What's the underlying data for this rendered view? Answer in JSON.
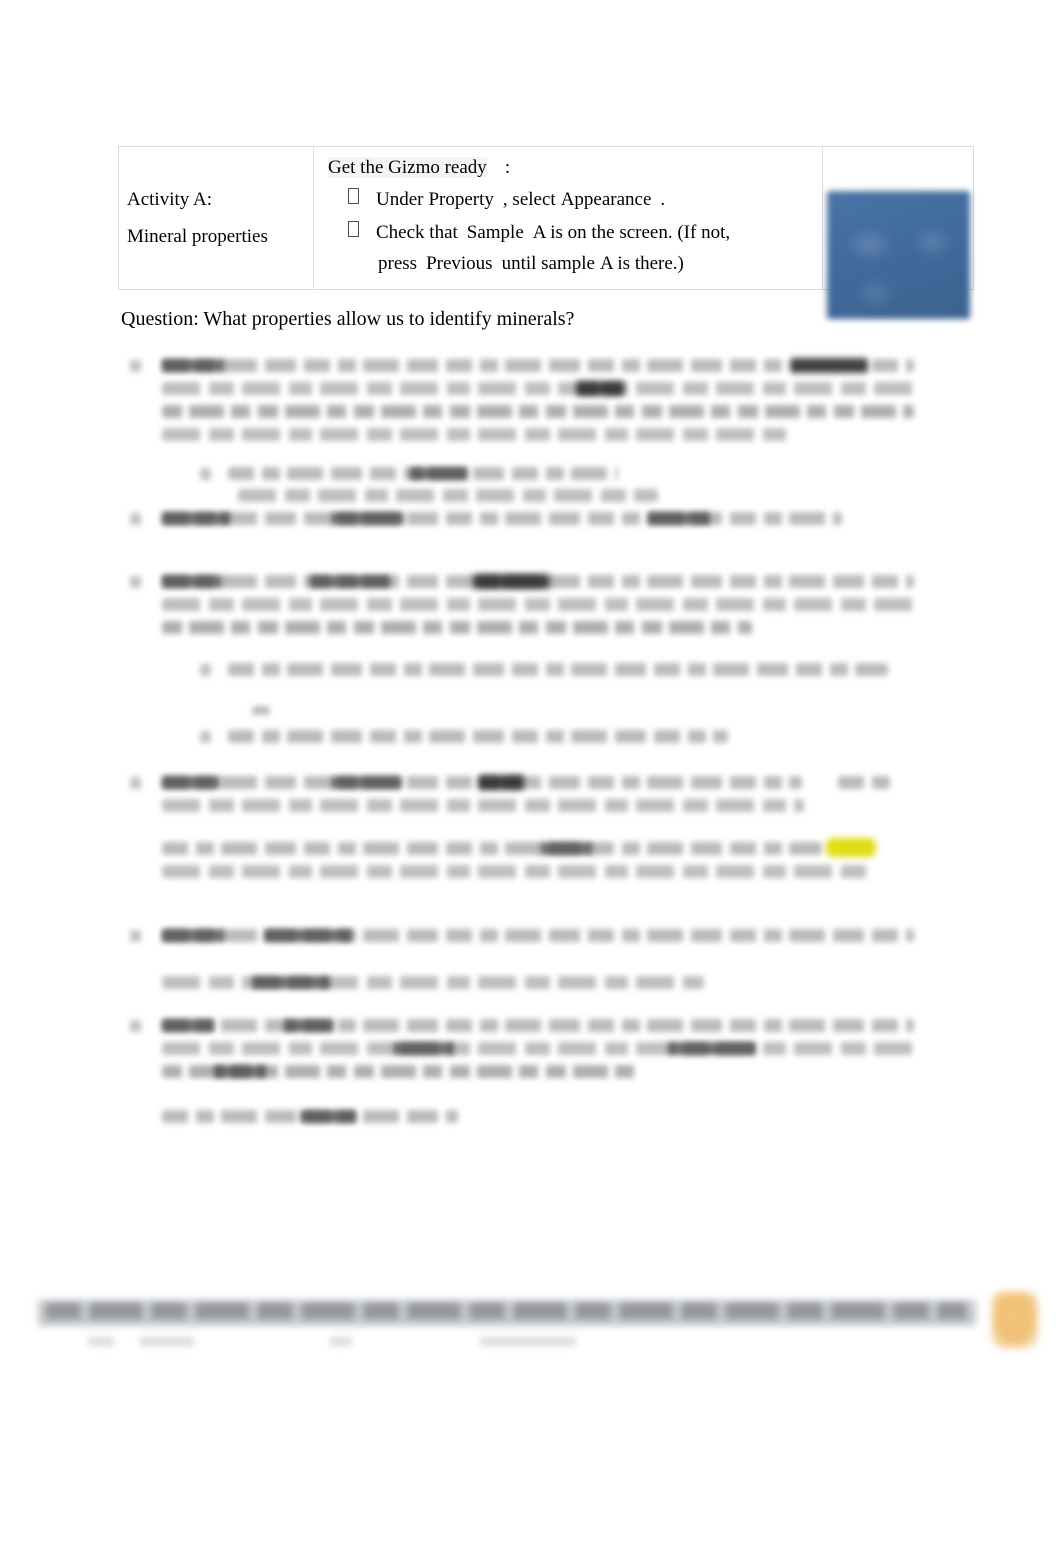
{
  "document": {
    "type": "worksheet",
    "question_line": "Question: What properties allow us to identify minerals?"
  },
  "activity_table": {
    "activity_cell": {
      "title": "Activity A:",
      "subtitle": "Mineral properties"
    },
    "instructions_cell": {
      "heading": "Get the Gizmo ready",
      "heading_colon": ":",
      "bullets": [
        {
          "icon": "bullet-box",
          "segments": [
            {
              "text": "Under",
              "bold": false
            },
            {
              "text": "Property",
              "bold": false
            },
            {
              "text": ", select",
              "bold": false
            },
            {
              "text": "Appearance",
              "bold": false
            },
            {
              "text": ".",
              "bold": false
            }
          ]
        },
        {
          "icon": "bullet-box",
          "segments": [
            {
              "text": "Check that",
              "bold": false
            },
            {
              "text": "Sample",
              "bold": false
            },
            {
              "text": "A is on the screen. (If not,",
              "bold": false
            },
            {
              "text": "press",
              "bold": false
            },
            {
              "text": "Previous",
              "bold": false
            },
            {
              "text": "until sample",
              "bold": false
            },
            {
              "text": "A is there.)",
              "bold": false
            }
          ]
        }
      ]
    },
    "image_cell": {
      "alt": "gizmo-screenshot-thumbnail",
      "state": "blurred",
      "color": "#416a9c"
    }
  },
  "body": {
    "state": "blurred-illegible",
    "note": "Numbered activity items with sub-lettered questions; text obscured.",
    "items": [
      {
        "number": "1.",
        "lines": 4,
        "has_redaction": true
      },
      {
        "sub": "a.",
        "lines": 2
      },
      {
        "number": "2.",
        "lines": 1,
        "has_bold": true
      },
      {
        "number": "3.",
        "lines": 3,
        "has_redaction": true
      },
      {
        "sub": "a.",
        "lines": 1
      },
      {
        "sub": "b.",
        "lines": 1
      },
      {
        "number": "4.",
        "lines": 2,
        "has_redaction": true
      },
      {
        "paragraph": true,
        "lines": 2,
        "has_highlight": true
      },
      {
        "number": "5.",
        "lines": 1
      },
      {
        "paragraph": true,
        "lines": 1
      },
      {
        "number": "6.",
        "lines": 3,
        "has_bold": true
      },
      {
        "paragraph": true,
        "lines": 1
      }
    ]
  },
  "footer": {
    "state": "blurred",
    "badge": {
      "name": "page-badge",
      "color": "#f0c076"
    },
    "bar_color": "#969aa0"
  },
  "colors": {
    "table_border": "#dcdcdc",
    "thumbnail_blue": "#416a9c",
    "highlight_yellow": "#dede14",
    "footer_orange": "#f0c076",
    "text": "#000000"
  }
}
